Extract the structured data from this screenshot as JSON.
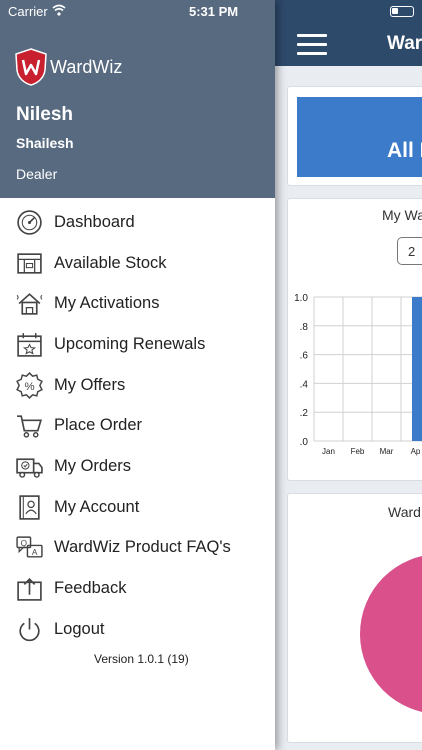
{
  "status_bar": {
    "carrier": "Carrier",
    "time": "5:31 PM"
  },
  "drawer": {
    "logo_text": "WardWiz",
    "user_first": "Nilesh",
    "user_last": "Shailesh",
    "role": "Dealer",
    "version": "Version 1.0.1 (19)",
    "menu": [
      {
        "label": "Dashboard",
        "icon": "dashboard-gauge-icon"
      },
      {
        "label": "Available Stock",
        "icon": "stock-box-icon"
      },
      {
        "label": "My Activations",
        "icon": "activation-house-icon"
      },
      {
        "label": "Upcoming Renewals",
        "icon": "calendar-icon"
      },
      {
        "label": "My Offers",
        "icon": "percent-badge-icon"
      },
      {
        "label": "Place Order",
        "icon": "cart-icon"
      },
      {
        "label": "My Orders",
        "icon": "delivery-truck-icon"
      },
      {
        "label": "My Account",
        "icon": "account-book-icon"
      },
      {
        "label": "WardWiz Product FAQ's",
        "icon": "faq-chat-icon"
      },
      {
        "label": "Feedback",
        "icon": "feedback-upload-icon"
      },
      {
        "label": "Logout",
        "icon": "power-icon"
      }
    ]
  },
  "main": {
    "title": "Ward",
    "card1_label": "All P",
    "card2_title": "My Wa",
    "year_pill": "2",
    "card3_title": "Ward"
  },
  "colors": {
    "header": "#2e4a6b",
    "drawer_header": "#586a80",
    "banner": "#3b7bc9",
    "bar": "#3b7bc9",
    "pie": "#d9508a"
  },
  "chart_data": {
    "type": "bar",
    "categories": [
      "Jan",
      "Feb",
      "Mar",
      "Ap"
    ],
    "values": [
      0,
      0,
      0,
      1.0
    ],
    "ylim": [
      0,
      1.0
    ],
    "yticks": [
      "1.0",
      ".8",
      ".6",
      ".4",
      ".2",
      ".0"
    ],
    "grid": true
  }
}
